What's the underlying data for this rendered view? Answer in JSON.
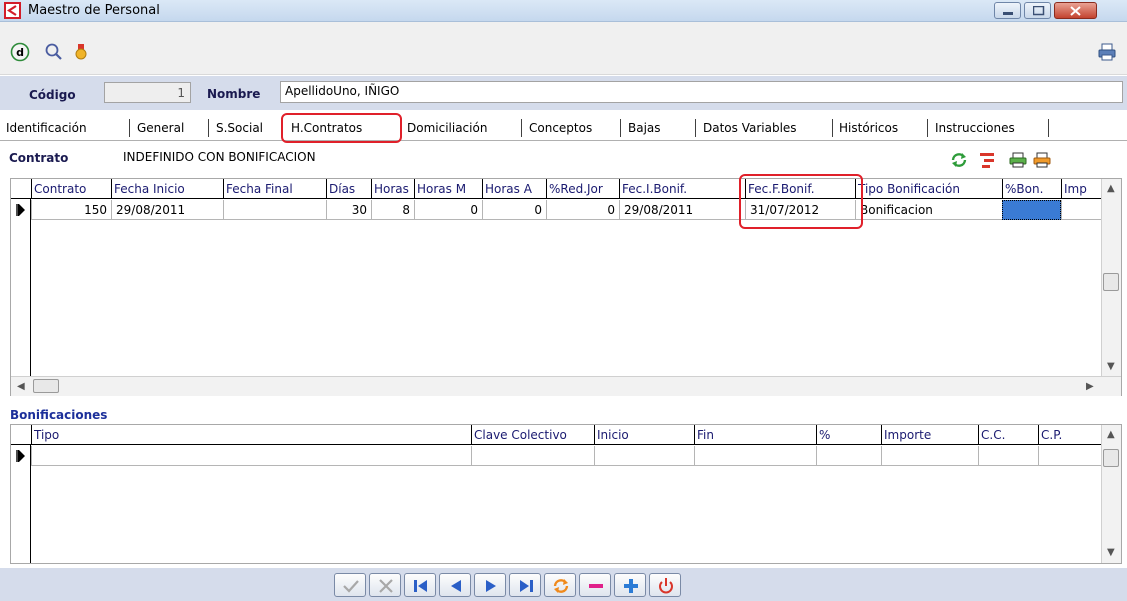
{
  "window": {
    "title": "Maestro de Personal"
  },
  "header": {
    "codigo_label": "Código",
    "codigo_value": "1",
    "nombre_label": "Nombre",
    "nombre_value": "ApellidoUno, IÑIGO"
  },
  "tabs": [
    {
      "label": "Identificación",
      "selected": false
    },
    {
      "label": "General",
      "selected": false
    },
    {
      "label": "S.Social",
      "selected": false
    },
    {
      "label": "H.Contratos",
      "selected": true
    },
    {
      "label": "Domiciliación",
      "selected": false
    },
    {
      "label": "Conceptos",
      "selected": false
    },
    {
      "label": "Bajas",
      "selected": false
    },
    {
      "label": "Datos Variables",
      "selected": false
    },
    {
      "label": "Históricos",
      "selected": false
    },
    {
      "label": "Instrucciones",
      "selected": false
    }
  ],
  "contrato": {
    "label": "Contrato",
    "value": "INDEFINIDO CON BONIFICACION"
  },
  "contracts_grid": {
    "columns": [
      "Contrato",
      "Fecha Inicio",
      "Fecha Final",
      "Días",
      "Horas",
      "Horas M",
      "Horas A",
      "%Red.Jor",
      "Fec.I.Bonif.",
      "Fec.F.Bonif.",
      "Tipo Bonificación",
      "%Bon.",
      "Imp"
    ],
    "rows": [
      [
        "150",
        "29/08/2011",
        "",
        "30",
        "8",
        "0",
        "0",
        "0",
        "29/08/2011",
        "31/07/2012",
        "Bonificacion",
        "",
        ""
      ]
    ]
  },
  "bonificaciones": {
    "label": "Bonificaciones",
    "columns": [
      "Tipo",
      "Clave Colectivo",
      "Inicio",
      "Fin",
      "%",
      "Importe",
      "C.C.",
      "C.P."
    ]
  },
  "colors": {
    "highlight": "#e0202a",
    "header_band": "#d5dceb",
    "label_blue": "#1c2f9a",
    "selected_cell": "#3a7bd5"
  },
  "icons": {
    "toolbar": [
      "d-circle-icon",
      "search-icon",
      "medal-icon",
      "printer-icon"
    ],
    "contrato_actions": [
      "refresh-icon",
      "filter-icon",
      "printer-green-icon",
      "printer-orange-icon"
    ],
    "nav": [
      "accept-icon",
      "cancel-icon",
      "first-record-icon",
      "previous-record-icon",
      "next-record-icon",
      "last-record-icon",
      "refresh-icon",
      "delete-icon",
      "add-icon",
      "power-icon"
    ]
  }
}
